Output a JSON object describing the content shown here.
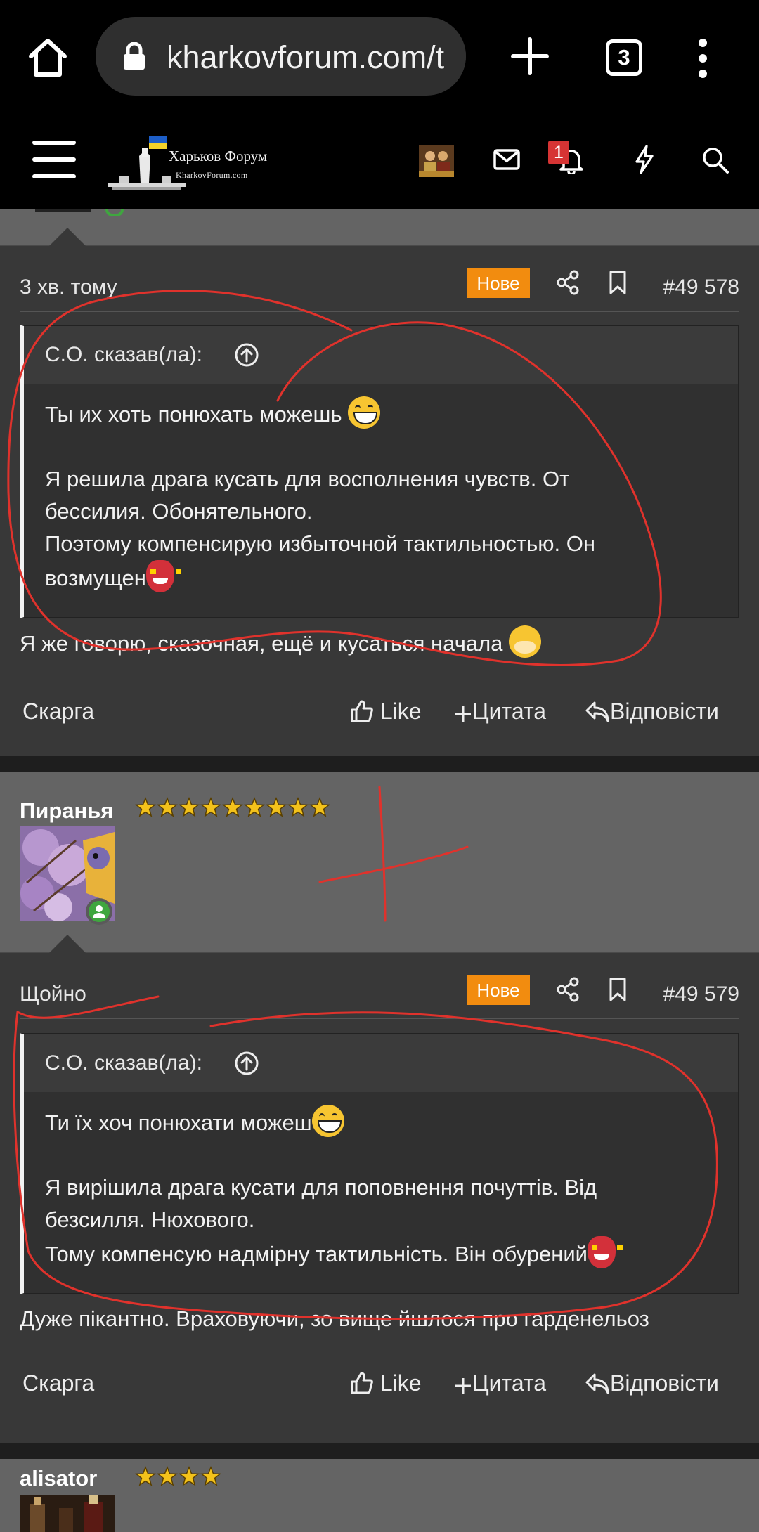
{
  "browser": {
    "url": "kharkovforum.com/t",
    "tab_count": "3"
  },
  "forum_header": {
    "logo_title": "Харьков Форум",
    "logo_subtitle": "KharkovForum.com",
    "notification_count": "1"
  },
  "posts": [
    {
      "time": "3 хв. тому",
      "badge": "Нове",
      "number": "#49 578",
      "quote": {
        "author": "С.О. сказав(ла):",
        "lines": [
          "Ты их хоть понюхать можешь",
          "Я решила драга кусать для восполнения чувств. От",
          "бессилия. Обонятельного.",
          "Поэтому компенсирую избыточной тактильностью. Он",
          "возмущен"
        ]
      },
      "reply": "Я же говорю, сказочная, ещё и кусаться начала",
      "actions": {
        "report": "Скарга",
        "like": "Like",
        "quote": "Цитата",
        "reply": "Відповісти"
      }
    },
    {
      "username": "Пиранья",
      "stars": 9,
      "time": "Щойно",
      "badge": "Нове",
      "number": "#49 579",
      "quote": {
        "author": "С.О. сказав(ла):",
        "lines": [
          "Ти їх хоч понюхати можеш",
          "Я вирішила драга кусати для поповнення почуттів. Від",
          "безсилля. Нюхового.",
          "Тому компенсую надмірну тактильність. Він обурений"
        ]
      },
      "reply": "Дуже пікантно. Враховуючи, зо вище йшлося про гарденельоз",
      "actions": {
        "report": "Скарга",
        "like": "Like",
        "quote": "Цитата",
        "reply": "Відповісти"
      }
    }
  ],
  "next_user": {
    "username": "alisator",
    "stars": 4
  },
  "colors": {
    "new_badge": "#f28c0f",
    "online": "#3fa63f",
    "annotation": "#e0322c",
    "post_bg": "#383838",
    "user_strip_bg": "#646464"
  }
}
